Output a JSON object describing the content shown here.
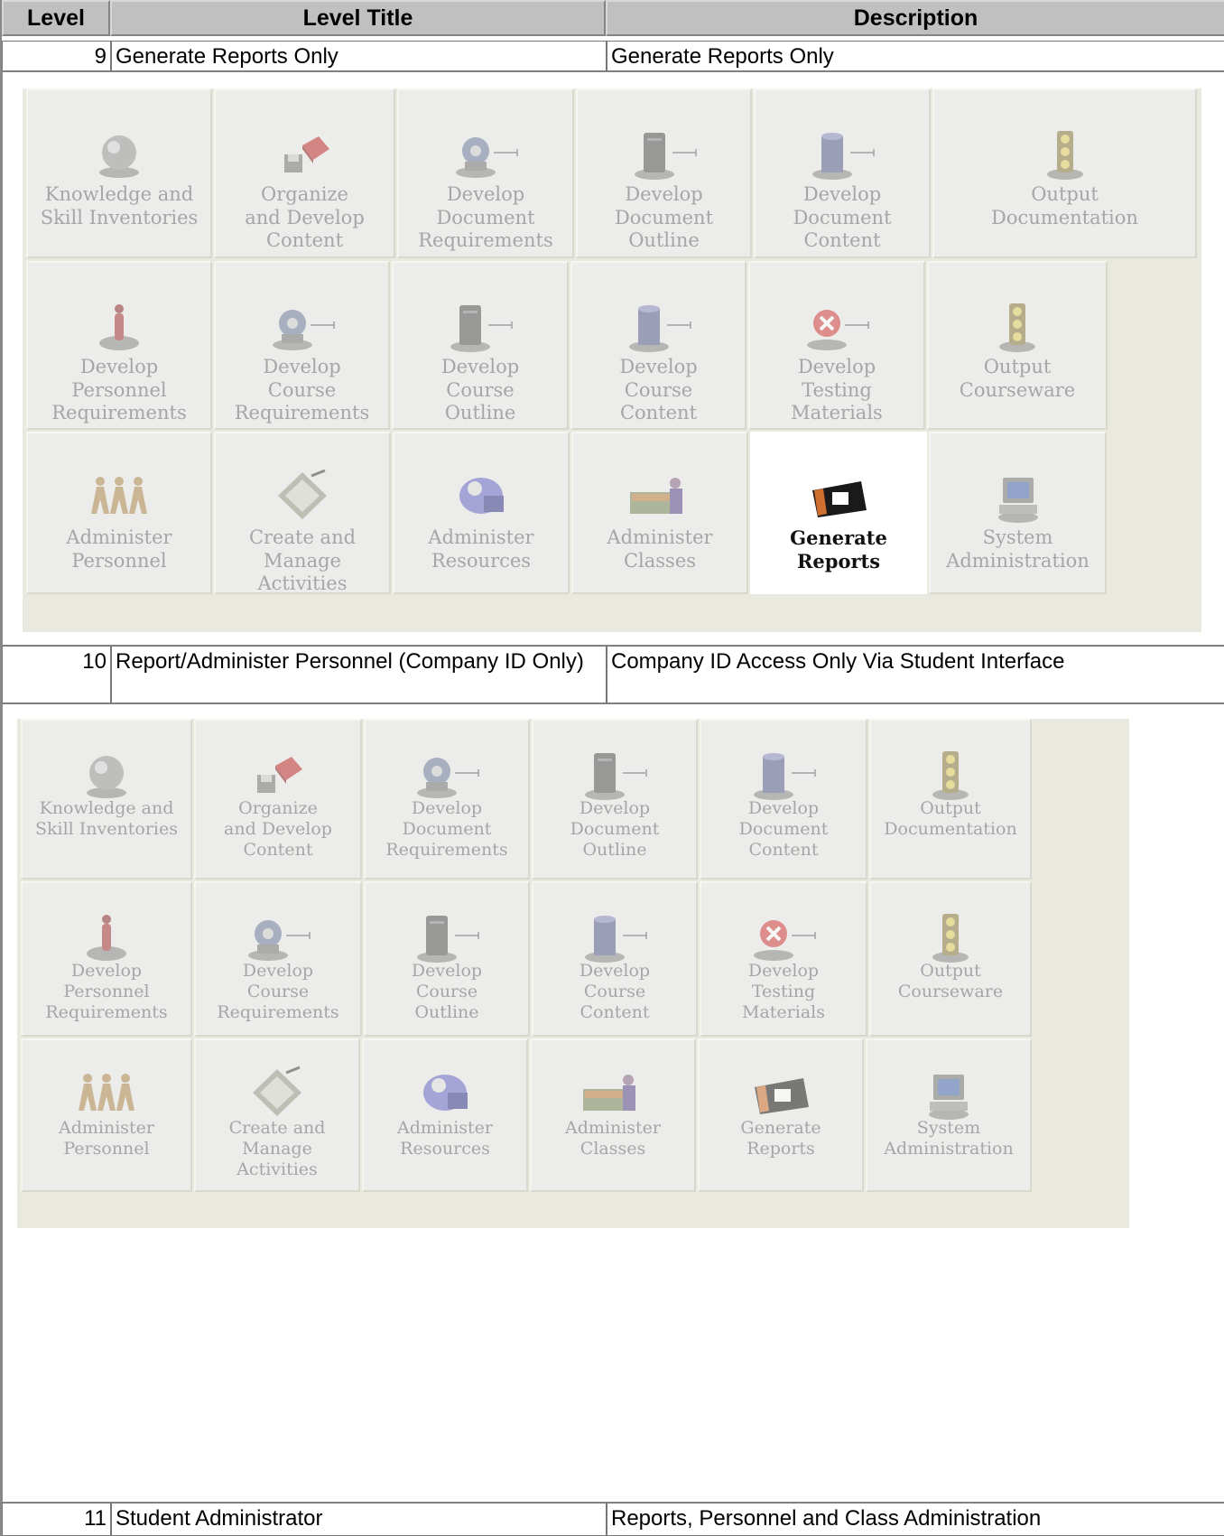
{
  "table": {
    "headers": [
      "Level",
      "Level Title",
      "Description"
    ],
    "rows": [
      {
        "level": "9",
        "title": "Generate Reports Only",
        "description": "Generate Reports Only"
      },
      {
        "level": "10",
        "title": "Report/Administer Personnel (Company ID Only)",
        "description": "Company ID Access Only Via Student Interface"
      },
      {
        "level": "11",
        "title": "Student Administrator",
        "description": "Reports, Personnel and Class Administration"
      }
    ]
  },
  "menu_panels": [
    {
      "active_item": "Generate Reports",
      "tiles": [
        {
          "label": "Knowledge and\nSkill Inventories",
          "icon": "globe-icon"
        },
        {
          "label": "Organize\nand Develop\nContent",
          "icon": "disk-book-icon"
        },
        {
          "label": "Develop\nDocument\nRequirements",
          "icon": "gear-arrow-icon"
        },
        {
          "label": "Develop\nDocument\nOutline",
          "icon": "server-arrow-icon"
        },
        {
          "label": "Develop\nDocument\nContent",
          "icon": "database-arrow-icon"
        },
        {
          "label": "Output\nDocumentation",
          "icon": "traffic-light-icon"
        },
        {
          "label": "Develop\nPersonnel\nRequirements",
          "icon": "figure-icon"
        },
        {
          "label": "Develop\nCourse\nRequirements",
          "icon": "gear-arrow-icon"
        },
        {
          "label": "Develop\nCourse\nOutline",
          "icon": "server-arrow-icon"
        },
        {
          "label": "Develop\nCourse\nContent",
          "icon": "database-arrow-icon"
        },
        {
          "label": "Develop\nTesting\nMaterials",
          "icon": "error-arrow-icon"
        },
        {
          "label": "Output\nCourseware",
          "icon": "traffic-light-icon"
        },
        {
          "label": "Administer\nPersonnel",
          "icon": "people-chain-icon"
        },
        {
          "label": "Create and\nManage\nActivities",
          "icon": "clipboard-icon"
        },
        {
          "label": "Administer\nResources",
          "icon": "resources-icon"
        },
        {
          "label": "Administer\nClasses",
          "icon": "classroom-icon"
        },
        {
          "label": "Generate\nReports",
          "icon": "film-slide-icon"
        },
        {
          "label": "System\nAdministration",
          "icon": "computer-icon"
        }
      ]
    },
    {
      "active_item": "",
      "tiles": [
        {
          "label": "Knowledge and\nSkill Inventories",
          "icon": "globe-icon"
        },
        {
          "label": "Organize\nand Develop\nContent",
          "icon": "disk-book-icon"
        },
        {
          "label": "Develop\nDocument\nRequirements",
          "icon": "gear-arrow-icon"
        },
        {
          "label": "Develop\nDocument\nOutline",
          "icon": "server-arrow-icon"
        },
        {
          "label": "Develop\nDocument\nContent",
          "icon": "database-arrow-icon"
        },
        {
          "label": "Output\nDocumentation",
          "icon": "traffic-light-icon"
        },
        {
          "label": "Develop\nPersonnel\nRequirements",
          "icon": "figure-icon"
        },
        {
          "label": "Develop\nCourse\nRequirements",
          "icon": "gear-arrow-icon"
        },
        {
          "label": "Develop\nCourse\nOutline",
          "icon": "server-arrow-icon"
        },
        {
          "label": "Develop\nCourse\nContent",
          "icon": "database-arrow-icon"
        },
        {
          "label": "Develop\nTesting\nMaterials",
          "icon": "error-arrow-icon"
        },
        {
          "label": "Output\nCourseware",
          "icon": "traffic-light-icon"
        },
        {
          "label": "Administer\nPersonnel",
          "icon": "people-chain-icon"
        },
        {
          "label": "Create and\nManage\nActivities",
          "icon": "clipboard-icon"
        },
        {
          "label": "Administer\nResources",
          "icon": "resources-icon"
        },
        {
          "label": "Administer\nClasses",
          "icon": "classroom-icon"
        },
        {
          "label": "Generate\nReports",
          "icon": "film-slide-icon"
        },
        {
          "label": "System\nAdministration",
          "icon": "computer-icon"
        }
      ]
    }
  ]
}
